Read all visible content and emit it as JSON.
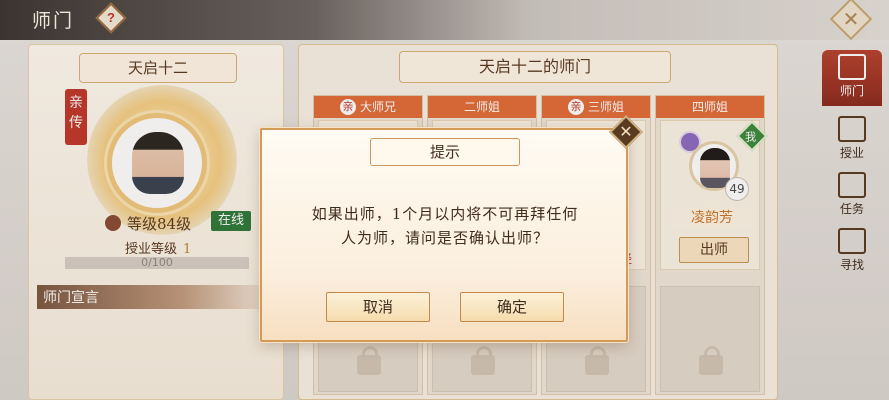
{
  "header": {
    "title": "师门",
    "help_icon": "question-diamond-icon",
    "close_icon": "close-diamond-icon"
  },
  "master": {
    "name": "天启十二",
    "ribbon": "亲传",
    "level_text": "等级84级",
    "status": "在线",
    "teach_label": "授业等级",
    "teach_level": "1",
    "xp_text": "0/100",
    "xp_progress": 0,
    "declaration_label": "师门宣言"
  },
  "sect": {
    "title": "天启十二的师门",
    "columns": [
      {
        "label": "大师兄",
        "seal": "亲",
        "has_seal": true
      },
      {
        "label": "二师姐",
        "seal": "",
        "has_seal": false
      },
      {
        "label": "三师姐",
        "seal": "亲",
        "has_seal": true
      },
      {
        "label": "四师姐",
        "seal": "",
        "has_seal": false
      }
    ],
    "visible_disciple": {
      "name": "凌韵芳",
      "level": "49",
      "kin_badge": "我",
      "action_label": "出师"
    },
    "partial_tag": "经"
  },
  "side_nav": [
    {
      "label": "师门",
      "icon": "gate-icon",
      "active": true
    },
    {
      "label": "授业",
      "icon": "book-icon",
      "active": false
    },
    {
      "label": "任务",
      "icon": "scroll-icon",
      "active": false
    },
    {
      "label": "寻找",
      "icon": "search-gate-icon",
      "active": false
    }
  ],
  "modal": {
    "title": "提示",
    "message_line1": "如果出师，1个月以内将不可再拜任何",
    "message_line2": "人为师，请问是否确认出师？",
    "cancel_label": "取消",
    "confirm_label": "确定"
  },
  "colors": {
    "accent_red": "#c0392b",
    "header_orange": "#e26d3a",
    "gold": "#c7a45f",
    "online_green": "#2f7a3c"
  }
}
